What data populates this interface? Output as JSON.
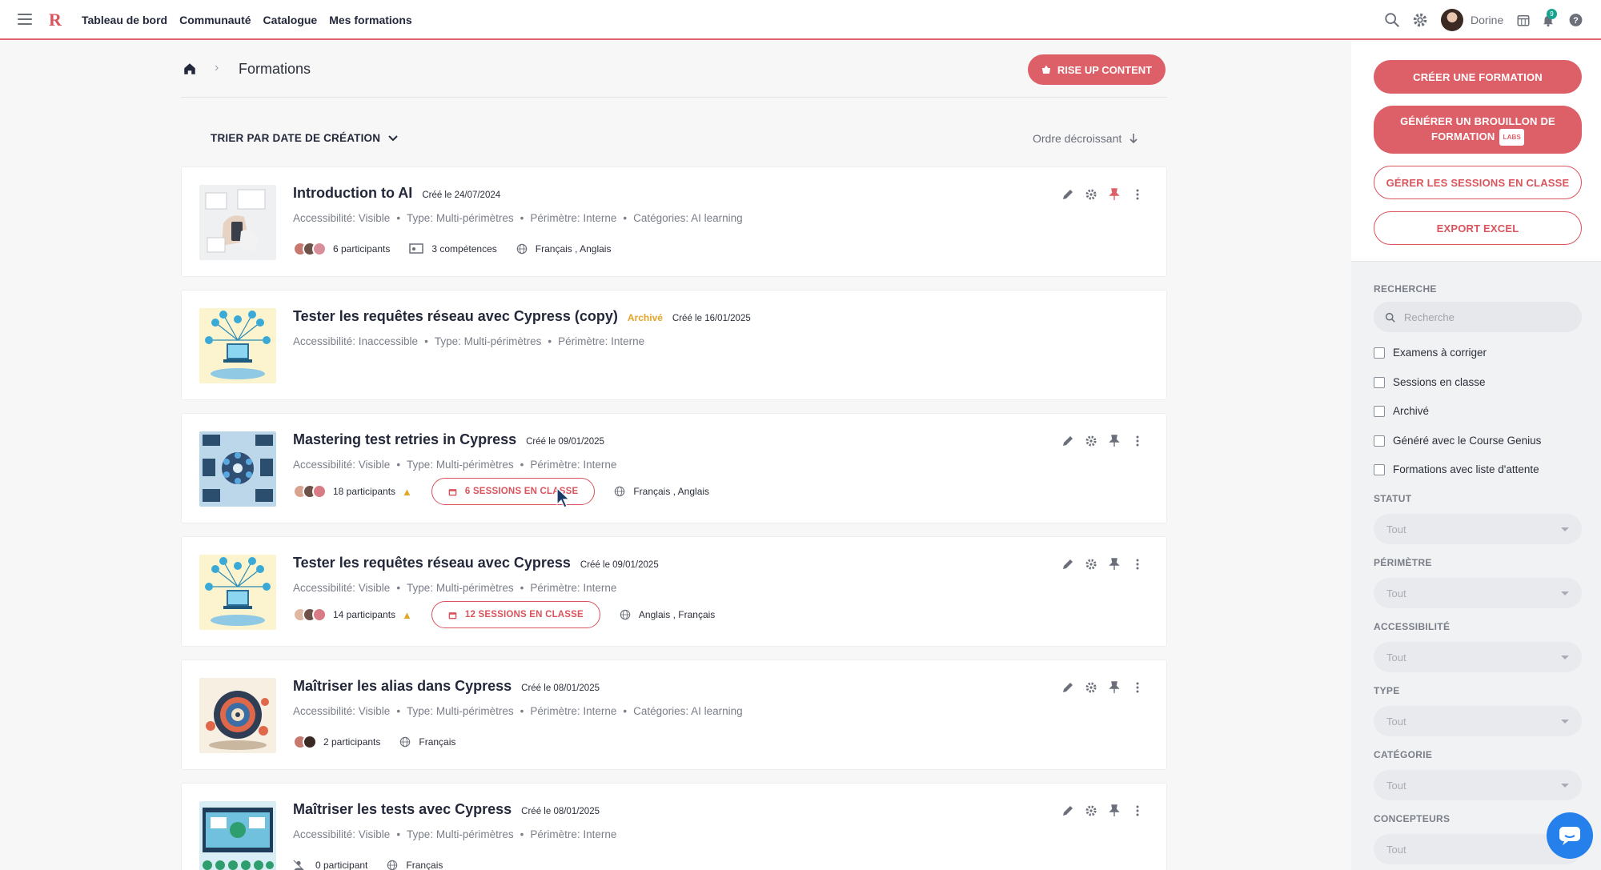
{
  "header": {
    "logo": "R",
    "nav": [
      "Tableau de bord",
      "Communauté",
      "Catalogue",
      "Mes formations"
    ],
    "username": "Dorine",
    "notification_count": "9"
  },
  "breadcrumb": {
    "title": "Formations"
  },
  "rise_button": "RISE UP CONTENT",
  "sort": {
    "label": "TRIER PAR DATE DE CRÉATION",
    "order": "Ordre décroissant"
  },
  "courses": [
    {
      "title": "Introduction to AI",
      "date": "Créé le 24/07/2024",
      "archived": "",
      "meta": [
        "Accessibilité: Visible",
        "Type: Multi-périmètres",
        "Périmètre: Interne",
        "Catégories: AI learning"
      ],
      "participants": "6 participants",
      "competences": "3 compétences",
      "sessions": "",
      "languages": "Français , Anglais",
      "pinned": true
    },
    {
      "title": "Tester les requêtes réseau avec Cypress (copy)",
      "date": "Créé le 16/01/2025",
      "archived": "Archivé",
      "meta": [
        "Accessibilité: Inaccessible",
        "Type: Multi-périmètres",
        "Périmètre: Interne"
      ]
    },
    {
      "title": "Mastering test retries in Cypress",
      "date": "Créé le 09/01/2025",
      "archived": "",
      "meta": [
        "Accessibilité: Visible",
        "Type: Multi-périmètres",
        "Périmètre: Interne"
      ],
      "participants": "18 participants",
      "sessions": "6 SESSIONS EN CLASSE",
      "languages": "Français , Anglais"
    },
    {
      "title": "Tester les requêtes réseau avec Cypress",
      "date": "Créé le 09/01/2025",
      "archived": "",
      "meta": [
        "Accessibilité: Visible",
        "Type: Multi-périmètres",
        "Périmètre: Interne"
      ],
      "participants": "14 participants",
      "sessions": "12 SESSIONS EN CLASSE",
      "languages": "Anglais , Français"
    },
    {
      "title": "Maîtriser les alias dans Cypress",
      "date": "Créé le 08/01/2025",
      "archived": "",
      "meta": [
        "Accessibilité: Visible",
        "Type: Multi-périmètres",
        "Périmètre: Interne",
        "Catégories: AI learning"
      ],
      "participants": "2 participants",
      "languages": "Français"
    },
    {
      "title": "Maîtriser les tests avec Cypress",
      "date": "Créé le 08/01/2025",
      "archived": "",
      "meta": [
        "Accessibilité: Visible",
        "Type: Multi-périmètres",
        "Périmètre: Interne"
      ],
      "participants": "0 participant",
      "languages": "Français"
    }
  ],
  "sidebar": {
    "create": "CRÉER UNE FORMATION",
    "generate": "GÉNÉRER UN BROUILLON DE FORMATION",
    "labs": "LABS",
    "manage_sessions": "GÉRER LES SESSIONS EN CLASSE",
    "export": "EXPORT EXCEL",
    "search_label": "RECHERCHE",
    "search_placeholder": "Recherche",
    "checkboxes": [
      "Examens à corriger",
      "Sessions en classe",
      "Archivé",
      "Généré avec le Course Genius",
      "Formations avec liste d'attente"
    ],
    "filters": [
      {
        "label": "STATUT",
        "value": "Tout"
      },
      {
        "label": "PÉRIMÈTRE",
        "value": "Tout"
      },
      {
        "label": "ACCESSIBILITÉ",
        "value": "Tout"
      },
      {
        "label": "TYPE",
        "value": "Tout"
      },
      {
        "label": "CATÉGORIE",
        "value": "Tout"
      },
      {
        "label": "CONCEPTEURS",
        "value": "Tout"
      }
    ]
  },
  "colors": {
    "accent": "#dd6068",
    "warning": "#e3a823",
    "archived": "#e5a427",
    "chat": "#2680eb"
  }
}
